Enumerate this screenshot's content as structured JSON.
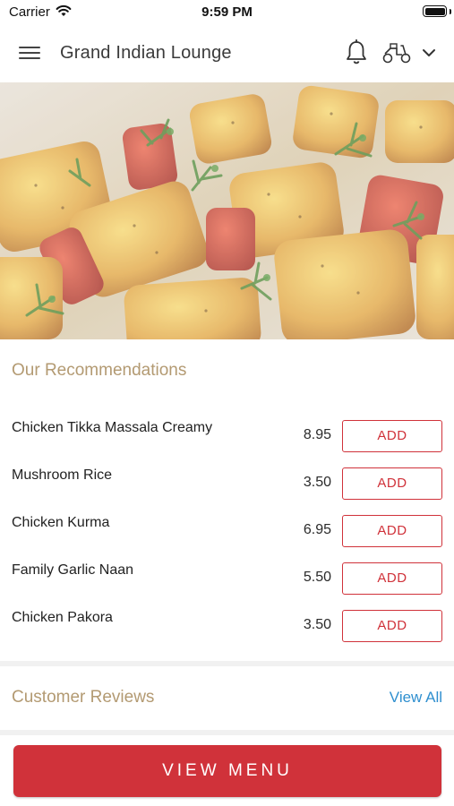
{
  "status_bar": {
    "carrier": "Carrier",
    "time": "9:59 PM"
  },
  "nav": {
    "title": "Grand Indian Lounge",
    "icons": [
      "hamburger-menu-icon",
      "bell-icon",
      "scooter-icon",
      "chevron-down-icon"
    ]
  },
  "hero": {
    "image": "grilled paneer tikka skewers with peppers and herbs"
  },
  "recommendations": {
    "title": "Our Recommendations",
    "items": [
      {
        "name": "Chicken Tikka Massala Creamy",
        "price": "8.95",
        "action": "ADD"
      },
      {
        "name": "Mushroom Rice",
        "price": "3.50",
        "action": "ADD"
      },
      {
        "name": "Chicken Kurma",
        "price": "6.95",
        "action": "ADD"
      },
      {
        "name": "Family Garlic Naan",
        "price": "5.50",
        "action": "ADD"
      },
      {
        "name": "Chicken Pakora",
        "price": "3.50",
        "action": "ADD"
      }
    ]
  },
  "reviews": {
    "title": "Customer Reviews",
    "link": "View All"
  },
  "footer": {
    "button": "VIEW MENU"
  },
  "colors": {
    "accent_red": "#d0323a",
    "section_title": "#b39a72",
    "link_blue": "#2f8fcf"
  }
}
